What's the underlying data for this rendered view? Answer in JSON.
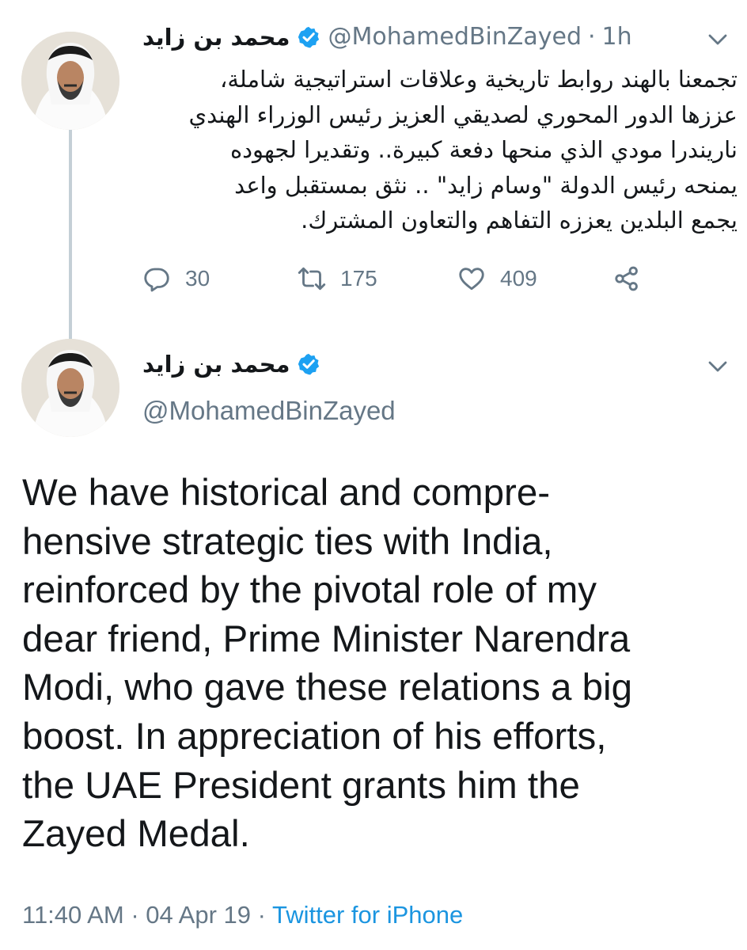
{
  "reply_tweet": {
    "display_name": "محمد بن زايد",
    "handle": "@MohamedBinZayed",
    "separator": "·",
    "time_ago": "1h",
    "text_lines": [
      "تجمعنا بالهند روابط تاريخية وعلاقات استراتيجية شاملة،",
      "عززها الدور المحوري لصديقي العزيز رئيس الوزراء الهندي",
      "ناريندرا مودي الذي منحها دفعة كبيرة.. وتقديرا لجهوده",
      "يمنحه رئيس الدولة \"وسام زايد\" .. نثق بمستقبل واعد",
      "يجمع البلدين يعززه التفاهم والتعاون المشترك."
    ],
    "actions": {
      "replies": "30",
      "retweets": "175",
      "likes": "409"
    },
    "icons": [
      "reply-icon",
      "retweet-icon",
      "like-icon",
      "share-icon",
      "verified-badge-icon",
      "chevron-down-icon"
    ]
  },
  "main_tweet": {
    "display_name": "محمد بن زايد",
    "handle": "@MohamedBinZayed",
    "text_lines": [
      "We have historical and compre-",
      "hensive strategic ties with India,",
      "reinforced by the pivotal role of my",
      "dear friend, Prime Minister Narendra",
      "Modi, who gave these relations a big",
      "boost. In appreciation of his efforts,",
      "the UAE President grants him the",
      "Zayed Medal."
    ],
    "time": "11:40 AM",
    "separator": "·",
    "date": "04 Apr 19",
    "source": "Twitter for iPhone"
  },
  "colors": {
    "text": "#14171a",
    "secondary": "#657786",
    "verified": "#1da1f2",
    "link": "#1b95e0",
    "thread_line": "#c4cfd6"
  }
}
